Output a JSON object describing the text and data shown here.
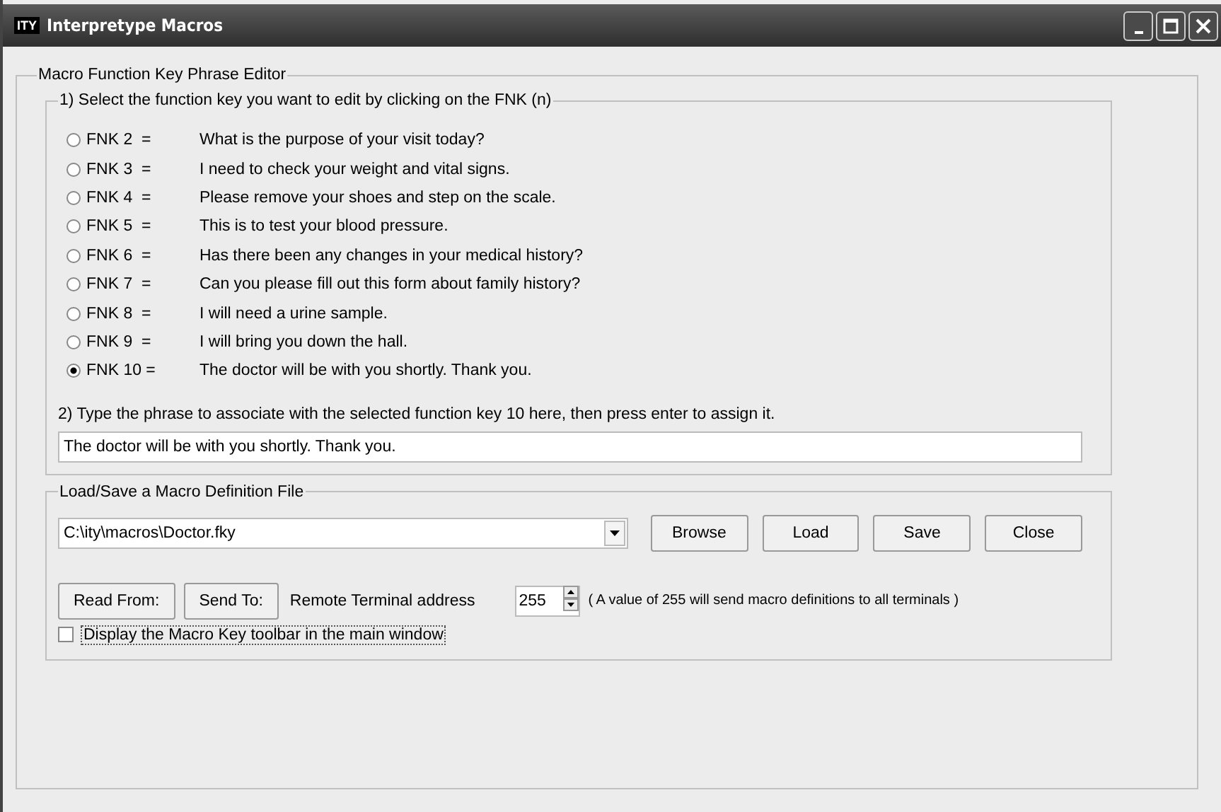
{
  "window": {
    "title": "Interpretype Macros",
    "app_icon": "ITY"
  },
  "editor": {
    "title": "Macro Function Key Phrase Editor",
    "select_group": {
      "title": "1) Select the function key you want to edit by clicking on the FNK (n)",
      "keys": [
        {
          "key": "FNK 2  =",
          "phrase": "What is the purpose of your visit today?",
          "selected": false
        },
        {
          "key": "FNK 3  =",
          "phrase": "I need to check your weight and vital signs.",
          "selected": false
        },
        {
          "key": "FNK 4  =",
          "phrase": "Please remove your shoes and step on the scale.",
          "selected": false
        },
        {
          "key": "FNK 5  =",
          "phrase": "This is to test your blood pressure.",
          "selected": false
        },
        {
          "key": "FNK 6  =",
          "phrase": "Has there been any changes in your medical history?",
          "selected": false
        },
        {
          "key": "FNK 7  =",
          "phrase": "Can you please fill out this form about family history?",
          "selected": false
        },
        {
          "key": "FNK 8  =",
          "phrase": "I will need a urine sample.",
          "selected": false
        },
        {
          "key": "FNK 9  =",
          "phrase": "I will bring you down the hall.",
          "selected": false
        },
        {
          "key": "FNK 10 =",
          "phrase": "The doctor will be with you shortly. Thank you.",
          "selected": true
        }
      ],
      "instruction": "2) Type the phrase to associate with the selected function key 10 here, then press enter to assign it.",
      "phrase_value": "The doctor will be with you shortly. Thank you."
    },
    "file_group": {
      "title": "Load/Save a Macro Definition File",
      "file_path": "C:\\ity\\macros\\Doctor.fky",
      "buttons": [
        "Browse",
        "Load",
        "Save",
        "Close"
      ],
      "read_button": "Read From:",
      "send_button": "Send To:",
      "address_label": "Remote Terminal address",
      "address_value": "255",
      "address_note": "( A value of 255 will send macro definitions to all terminals )",
      "toolbar_checkbox": {
        "label": "Display the Macro Key toolbar in the main window",
        "checked": false
      }
    }
  }
}
